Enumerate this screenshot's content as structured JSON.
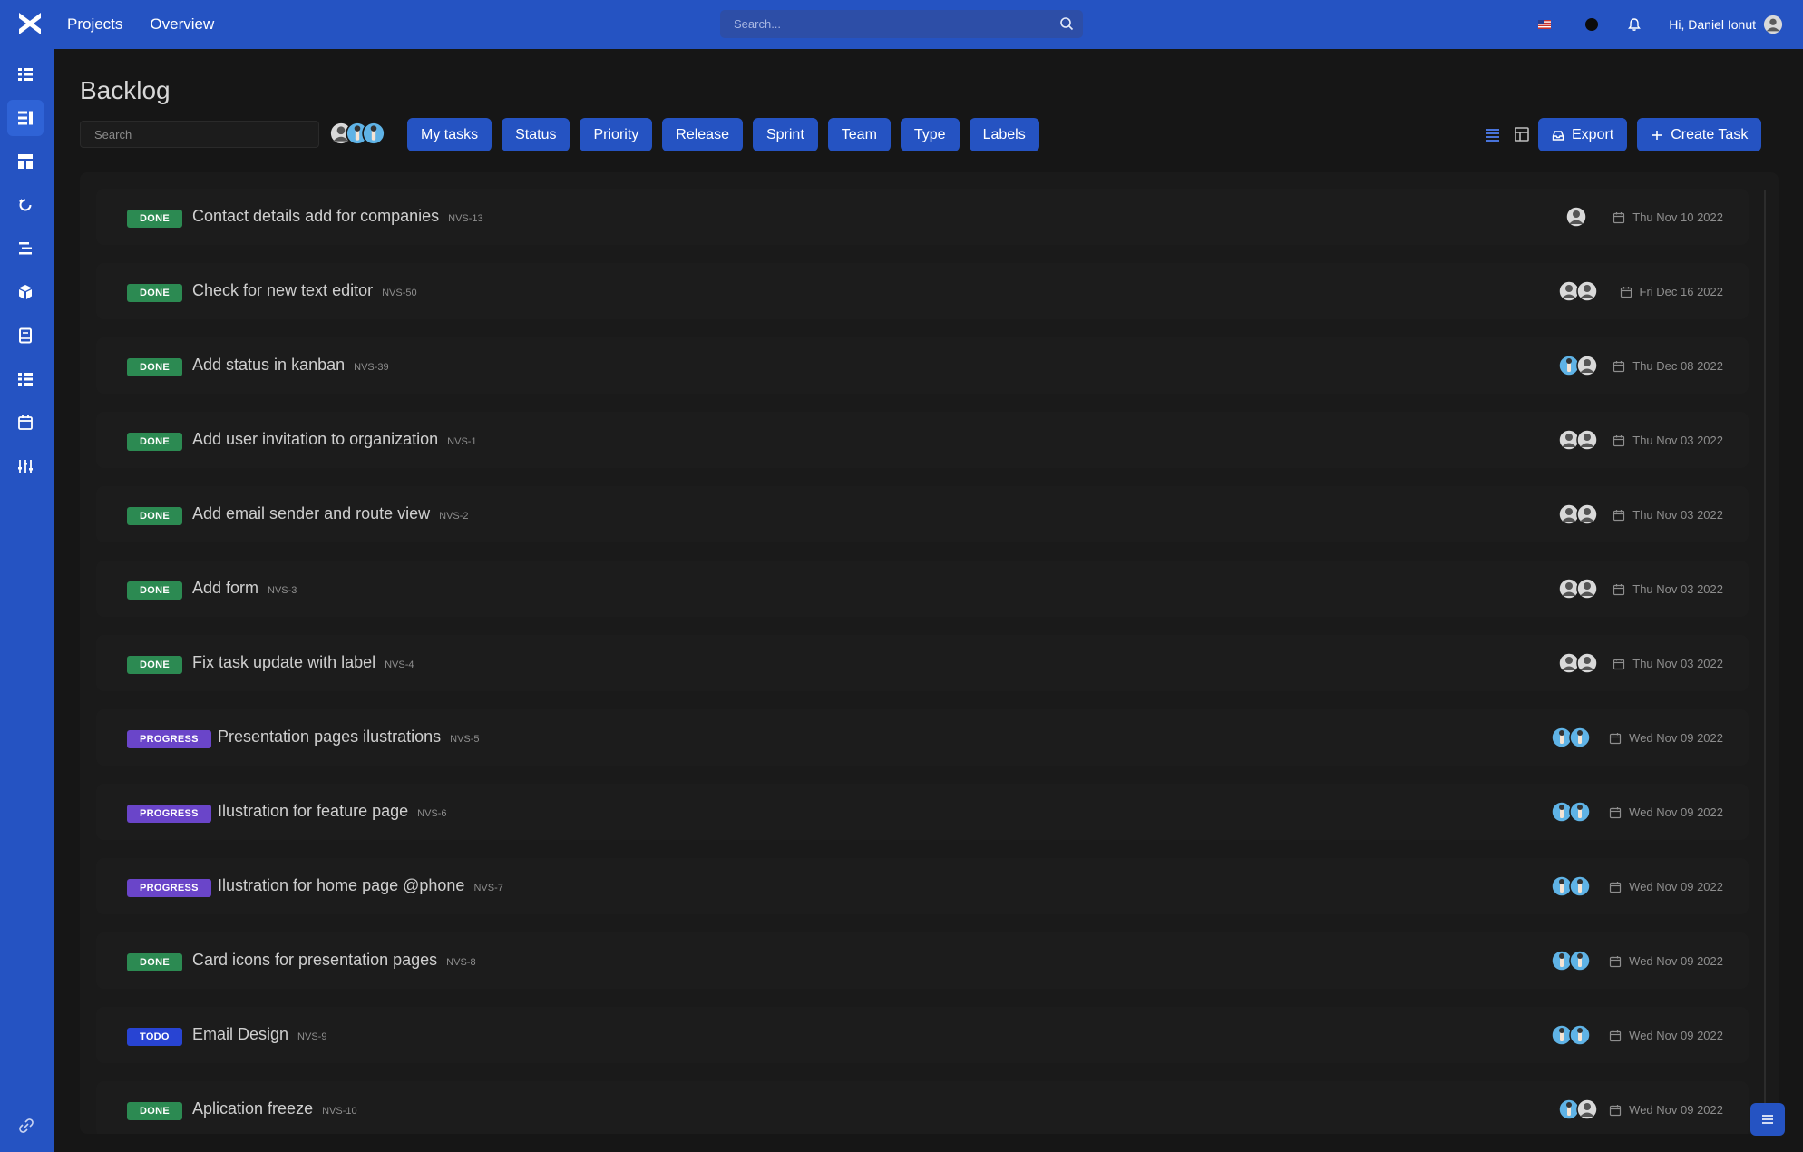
{
  "topbar": {
    "nav": [
      "Projects",
      "Overview"
    ],
    "search_placeholder": "Search...",
    "greeting": "Hi, Daniel Ionut"
  },
  "sidebar": {
    "icons": [
      "backlog-icon",
      "list-icon",
      "board-icon",
      "refresh-icon",
      "timeline-icon",
      "cube-icon",
      "book-icon",
      "tasks-icon",
      "calendar-icon",
      "sliders-icon"
    ],
    "active_index": 1
  },
  "page": {
    "title": "Backlog",
    "search_placeholder": "Search"
  },
  "filters": [
    "My tasks",
    "Status",
    "Priority",
    "Release",
    "Sprint",
    "Team",
    "Type",
    "Labels"
  ],
  "actions": {
    "export": "Export",
    "create": "Create Task"
  },
  "colors": {
    "accent": "#2553c2",
    "done": "#2c8a52",
    "progress": "#6a45c9",
    "todo": "#2844d3"
  },
  "tasks": [
    {
      "status": "DONE",
      "title": "Contact details add for companies",
      "key": "NVS-13",
      "avatars": [
        "gray"
      ],
      "date": "Thu Nov 10 2022"
    },
    {
      "status": "DONE",
      "title": "Check for new text editor",
      "key": "NVS-50",
      "avatars": [
        "gray",
        "gray"
      ],
      "date": "Fri Dec 16 2022"
    },
    {
      "status": "DONE",
      "title": "Add status in kanban",
      "key": "NVS-39",
      "avatars": [
        "blue",
        "gray"
      ],
      "date": "Thu Dec 08 2022"
    },
    {
      "status": "DONE",
      "title": "Add user invitation to organization",
      "key": "NVS-1",
      "avatars": [
        "gray",
        "gray"
      ],
      "date": "Thu Nov 03 2022"
    },
    {
      "status": "DONE",
      "title": "Add email sender and route view",
      "key": "NVS-2",
      "avatars": [
        "gray",
        "gray"
      ],
      "date": "Thu Nov 03 2022"
    },
    {
      "status": "DONE",
      "title": "Add form",
      "key": "NVS-3",
      "avatars": [
        "gray",
        "gray"
      ],
      "date": "Thu Nov 03 2022"
    },
    {
      "status": "DONE",
      "title": "Fix task update with label",
      "key": "NVS-4",
      "avatars": [
        "gray",
        "gray"
      ],
      "date": "Thu Nov 03 2022"
    },
    {
      "status": "PROGRESS",
      "title": "Presentation pages ilustrations",
      "key": "NVS-5",
      "avatars": [
        "blue",
        "blue"
      ],
      "date": "Wed Nov 09 2022"
    },
    {
      "status": "PROGRESS",
      "title": "Ilustration for feature page",
      "key": "NVS-6",
      "avatars": [
        "blue",
        "blue"
      ],
      "date": "Wed Nov 09 2022"
    },
    {
      "status": "PROGRESS",
      "title": "Ilustration for home page @phone",
      "key": "NVS-7",
      "avatars": [
        "blue",
        "blue"
      ],
      "date": "Wed Nov 09 2022"
    },
    {
      "status": "DONE",
      "title": "Card icons for presentation pages",
      "key": "NVS-8",
      "avatars": [
        "blue",
        "blue"
      ],
      "date": "Wed Nov 09 2022"
    },
    {
      "status": "TODO",
      "title": "Email Design",
      "key": "NVS-9",
      "avatars": [
        "blue",
        "blue"
      ],
      "date": "Wed Nov 09 2022"
    },
    {
      "status": "DONE",
      "title": "Aplication freeze",
      "key": "NVS-10",
      "avatars": [
        "blue",
        "gray"
      ],
      "date": "Wed Nov 09 2022"
    }
  ]
}
